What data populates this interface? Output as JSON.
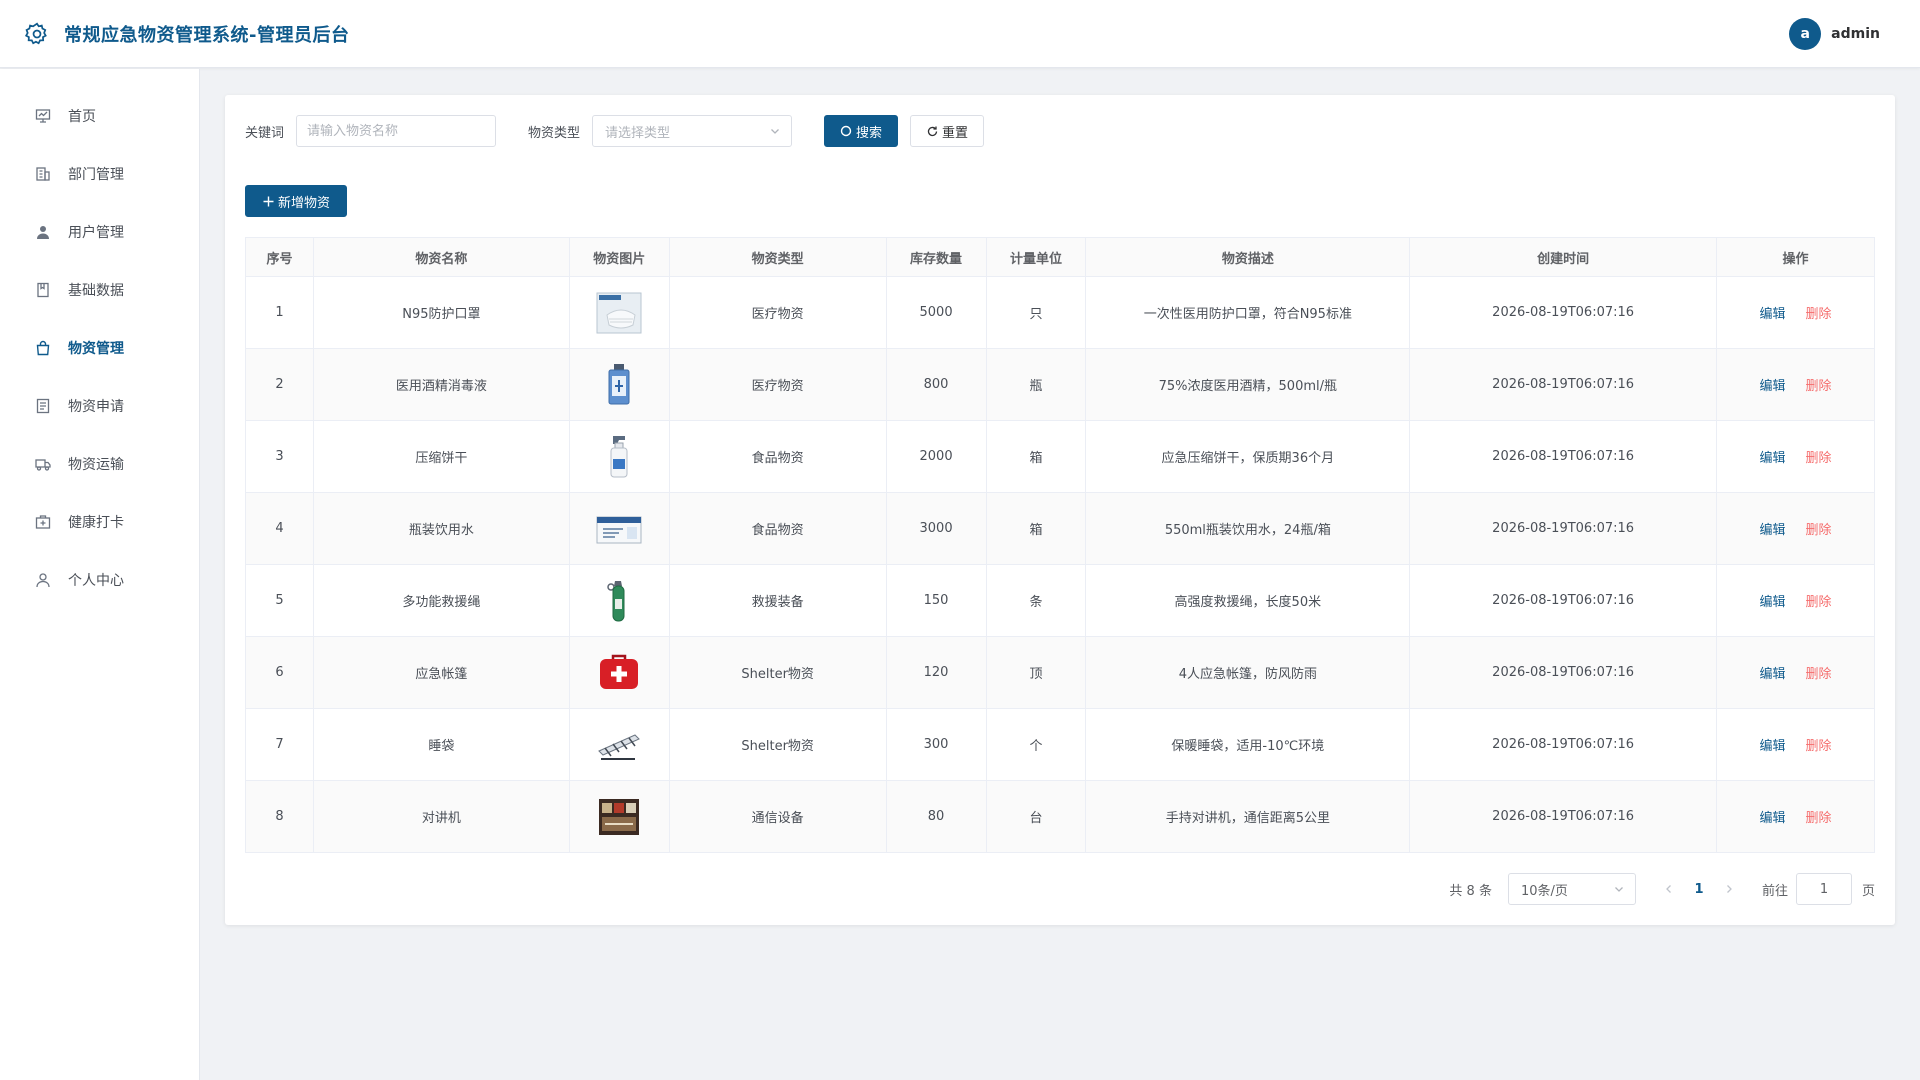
{
  "header": {
    "logo_icon": "gear-icon",
    "title": "常规应急物资管理系统-管理员后台",
    "avatar_letter": "a",
    "username": "admin",
    "brand_color": "#0f5a8c"
  },
  "sidebar": {
    "items": [
      {
        "label": "首页",
        "icon": "monitor-icon",
        "active": false
      },
      {
        "label": "部门管理",
        "icon": "building-icon",
        "active": false
      },
      {
        "label": "用户管理",
        "icon": "user-icon",
        "active": false
      },
      {
        "label": "基础数据",
        "icon": "notebook-icon",
        "active": false
      },
      {
        "label": "物资管理",
        "icon": "bag-icon",
        "active": true
      },
      {
        "label": "物资申请",
        "icon": "document-icon",
        "active": false
      },
      {
        "label": "物资运输",
        "icon": "truck-icon",
        "active": false
      },
      {
        "label": "健康打卡",
        "icon": "first-aid-icon",
        "active": false
      },
      {
        "label": "个人中心",
        "icon": "person-icon",
        "active": false
      }
    ]
  },
  "search": {
    "keyword_label": "关键词",
    "keyword_placeholder": "请输入物资名称",
    "keyword_value": "",
    "type_label": "物资类型",
    "type_placeholder": "请选择类型",
    "search_button": "搜索",
    "reset_button": "重置",
    "add_button": "新增物资"
  },
  "table": {
    "columns": [
      "序号",
      "物资名称",
      "物资图片",
      "物资类型",
      "库存数量",
      "计量单位",
      "物资描述",
      "创建时间",
      "操作"
    ],
    "rows": [
      {
        "no": "1",
        "name": "N95防护口罩",
        "image": "mask-box-thumb",
        "type": "医疗物资",
        "qty": "5000",
        "unit": "只",
        "desc": "一次性医用防护口罩，符合N95标准",
        "created": "2026-08-19T06:07:16"
      },
      {
        "no": "2",
        "name": "医用酒精消毒液",
        "image": "alcohol-bottle-thumb",
        "type": "医疗物资",
        "qty": "800",
        "unit": "瓶",
        "desc": "75%浓度医用酒精，500ml/瓶",
        "created": "2026-08-19T06:07:16"
      },
      {
        "no": "3",
        "name": "压缩饼干",
        "image": "spray-bottle-thumb",
        "type": "食品物资",
        "qty": "2000",
        "unit": "箱",
        "desc": "应急压缩饼干，保质期36个月",
        "created": "2026-08-19T06:07:16"
      },
      {
        "no": "4",
        "name": "瓶装饮用水",
        "image": "glove-box-thumb",
        "type": "食品物资",
        "qty": "3000",
        "unit": "箱",
        "desc": "550ml瓶装饮用水，24瓶/箱",
        "created": "2026-08-19T06:07:16"
      },
      {
        "no": "5",
        "name": "多功能救援绳",
        "image": "oxygen-tank-thumb",
        "type": "救援装备",
        "qty": "150",
        "unit": "条",
        "desc": "高强度救援绳，长度50米",
        "created": "2026-08-19T06:07:16"
      },
      {
        "no": "6",
        "name": "应急帐篷",
        "image": "first-aid-kit-thumb",
        "type": "Shelter物资",
        "qty": "120",
        "unit": "顶",
        "desc": "4人应急帐篷，防风防雨",
        "created": "2026-08-19T06:07:16"
      },
      {
        "no": "7",
        "name": "睡袋",
        "image": "stretcher-thumb",
        "type": "Shelter物资",
        "qty": "300",
        "unit": "个",
        "desc": "保暖睡袋，适用-10℃环境",
        "created": "2026-08-19T06:07:16"
      },
      {
        "no": "8",
        "name": "对讲机",
        "image": "supplies-kit-thumb",
        "type": "通信设备",
        "qty": "80",
        "unit": "台",
        "desc": "手持对讲机，通信距离5公里",
        "created": "2026-08-19T06:07:16"
      }
    ],
    "edit_label": "编辑",
    "delete_label": "删除"
  },
  "pagination": {
    "total_text": "共 8 条",
    "page_size": "10条/页",
    "current_page": "1",
    "goto_label": "前往",
    "goto_value": "1",
    "goto_unit": "页"
  }
}
